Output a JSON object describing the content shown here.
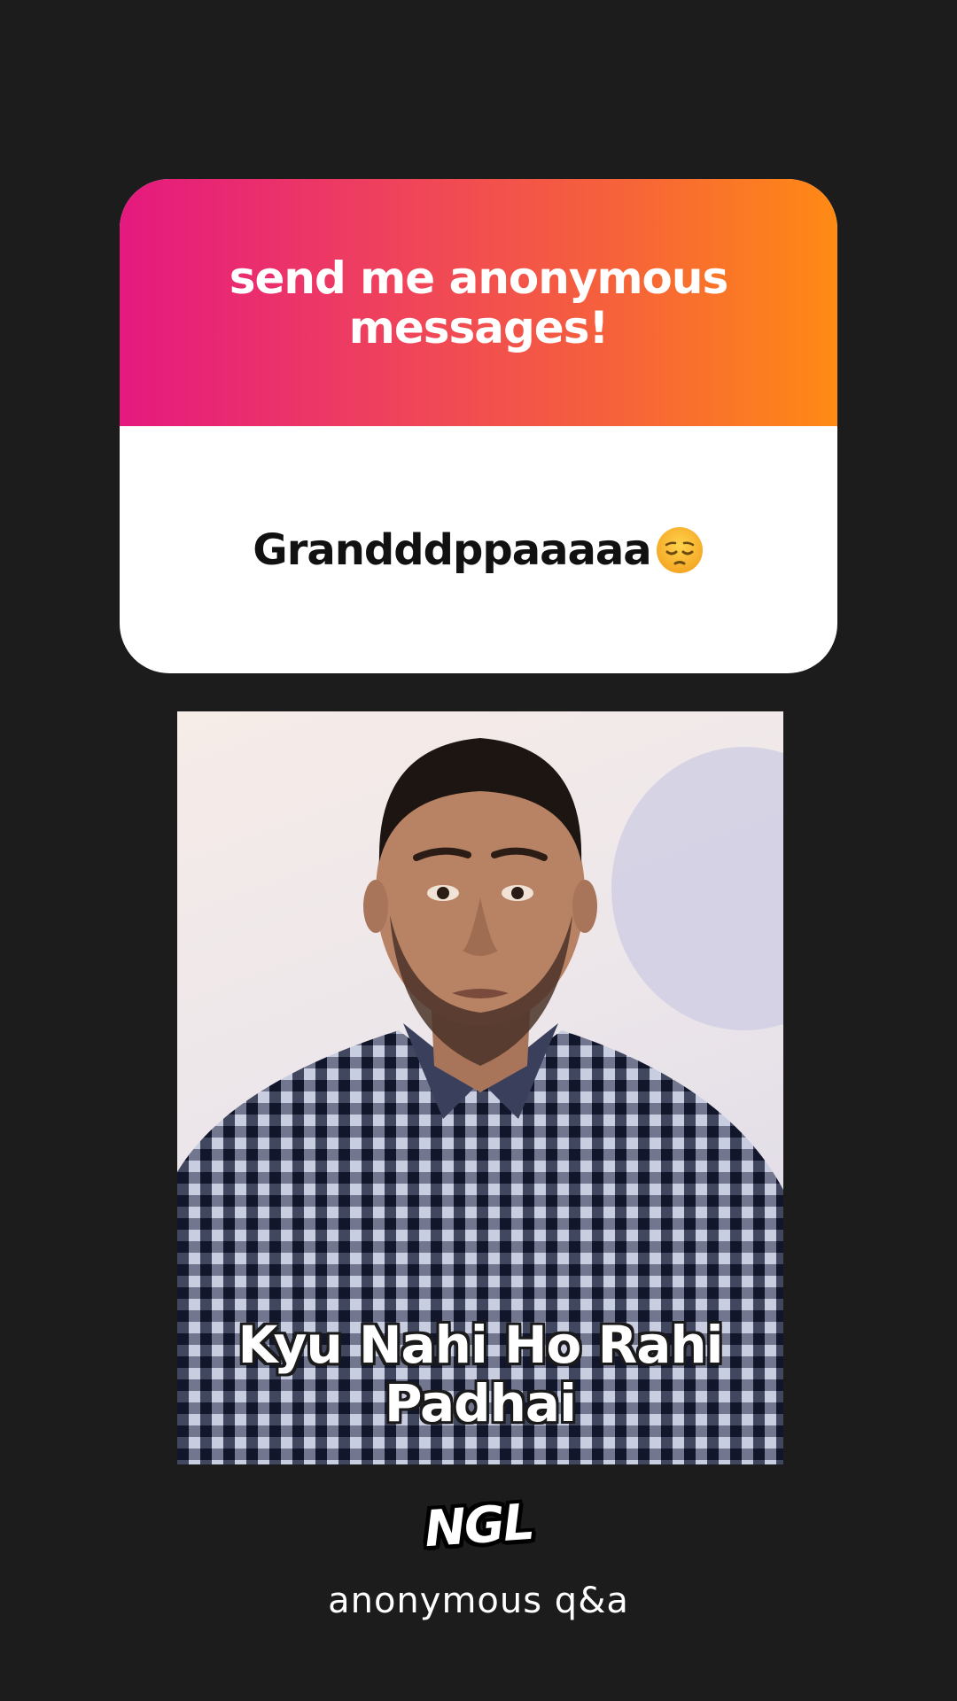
{
  "card": {
    "title": "send me anonymous messages!",
    "answer": "Granddd​ppaaaaa"
  },
  "card_colors": {
    "gradient_start": "#e5197f",
    "gradient_end": "#ff8a14",
    "body_background": "#ffffff"
  },
  "emoji": {
    "name": "pensive-face-icon"
  },
  "photo": {
    "caption_line1": "Kyu Nahi Ho Rahi",
    "caption_line2": "Padhai"
  },
  "footer": {
    "logo": "NGL",
    "tagline": "anonymous q&a"
  },
  "colors": {
    "background": "#1c1c1c"
  }
}
